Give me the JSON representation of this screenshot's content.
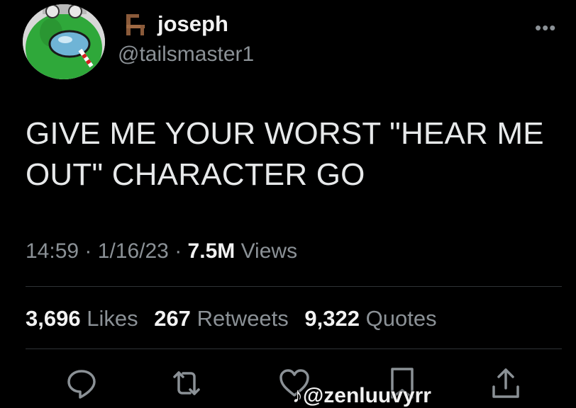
{
  "author": {
    "display_name": "joseph",
    "handle": "@tailsmaster1",
    "badge_icon": "chair-icon",
    "avatar_icon": "green-crewmate-avatar"
  },
  "more_icon": "more-options-icon",
  "tweet": {
    "text": "GIVE ME YOUR WORST \"HEAR ME OUT\" CHARACTER GO"
  },
  "meta": {
    "time": "14:59",
    "separator": "·",
    "date": "1/16/23",
    "views_count": "7.5M",
    "views_label": "Views"
  },
  "stats": {
    "likes_count": "3,696",
    "likes_label": "Likes",
    "retweets_count": "267",
    "retweets_label": "Retweets",
    "quotes_count": "9,322",
    "quotes_label": "Quotes"
  },
  "actions": [
    "reply-icon",
    "retweet-icon",
    "like-icon",
    "bookmark-icon",
    "share-icon"
  ],
  "watermark": "@zenluuvyrr",
  "colors": {
    "background": "#000000",
    "text": "#e7e9ea",
    "secondary": "#8b9196",
    "divider": "#2f3336"
  }
}
